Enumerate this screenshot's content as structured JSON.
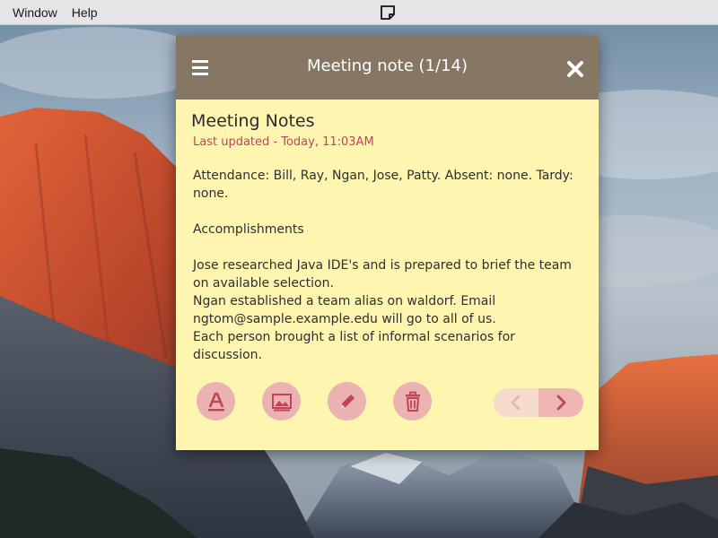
{
  "menubar": {
    "items": [
      "Window",
      "Help"
    ],
    "app_icon": "sticky-note-icon"
  },
  "window": {
    "title": "Meeting note (1/14)",
    "menu_icon": "hamburger-menu-icon",
    "close_icon": "close-icon",
    "header_color": "#867664",
    "background_color": "#fdf5b0"
  },
  "note": {
    "title": "Meeting Notes",
    "updated": "Last updated - Today, 11:03AM",
    "body": {
      "attendance": "Attendance: Bill, Ray, Ngan, Jose, Patty.  Absent: none.  Tardy: none.",
      "heading": "Accomplishments",
      "line1": "Jose researched Java IDE's and is prepared to brief the team on available selection.",
      "line2": "Ngan established a team alias on waldorf.  Email ngtom@sample.example.edu will go to all of us.",
      "line3": "Each person brought a list of informal scenarios for discussion."
    }
  },
  "toolbar": {
    "buttons": [
      "text-format-icon",
      "image-icon",
      "pencil-icon",
      "trash-icon"
    ],
    "accent_color": "#c0445a",
    "prev_icon": "chevron-left-icon",
    "next_icon": "chevron-right-icon"
  }
}
